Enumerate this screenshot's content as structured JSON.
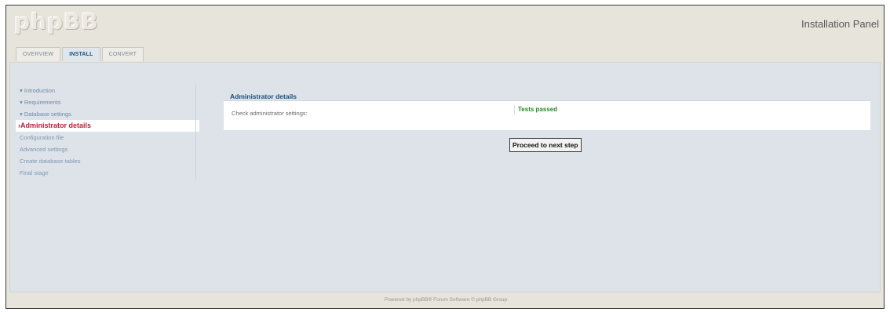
{
  "header": {
    "logo": "phpBB",
    "panel_title": "Installation Panel"
  },
  "tabs": [
    {
      "label": "OVERVIEW"
    },
    {
      "label": "INSTALL"
    },
    {
      "label": "CONVERT"
    }
  ],
  "sidebar": {
    "items": [
      {
        "label": "▾ Introduction"
      },
      {
        "label": "▾ Requirements"
      },
      {
        "label": "▾ Database settings"
      },
      {
        "label": "›Administrator details"
      },
      {
        "label": "Configuration file"
      },
      {
        "label": "Advanced settings"
      },
      {
        "label": "Create database tables"
      },
      {
        "label": "Final stage"
      }
    ]
  },
  "main": {
    "title": "Administrator details",
    "check_label": "Check administrator settings:",
    "check_result": "Tests passed",
    "proceed_button": "Proceed to next step"
  },
  "footer": {
    "text": "Powered by phpBB® Forum Software © phpBB Group"
  },
  "colors": {
    "active_step": "#b5203b",
    "passed": "#288a28",
    "heading": "#1e4f7a"
  }
}
